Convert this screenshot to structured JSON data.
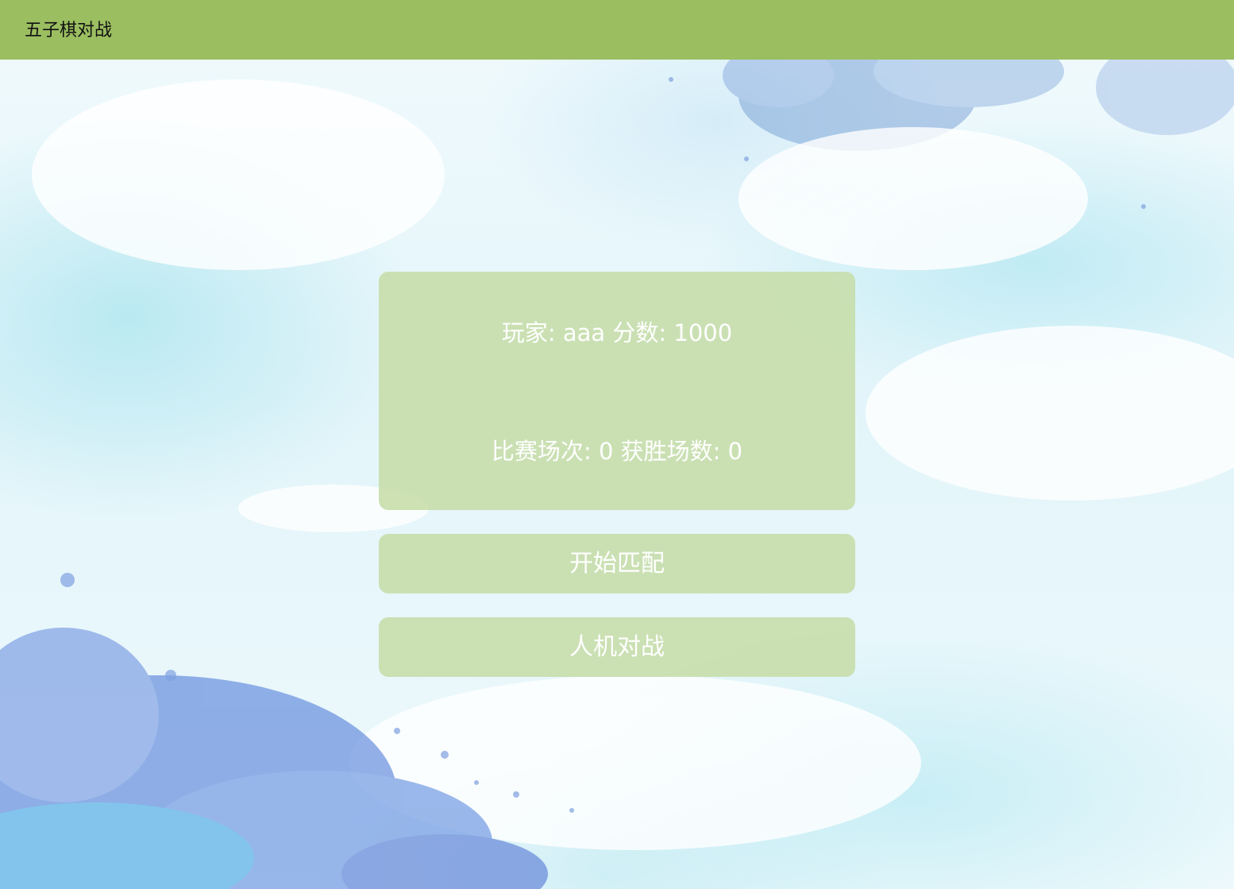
{
  "app": {
    "title": "五子棋对战"
  },
  "player": {
    "label": "玩家",
    "name": "aaa",
    "score_label": "分数",
    "score": 1000
  },
  "stats": {
    "matches_label": "比赛场次",
    "matches": 0,
    "wins_label": "获胜场数",
    "wins": 0
  },
  "buttons": {
    "start_match": "开始匹配",
    "vs_ai": "人机对战"
  },
  "colors": {
    "topbar": "#9bbe61",
    "panel": "#c6dda8",
    "panel_text": "#ffffff"
  }
}
